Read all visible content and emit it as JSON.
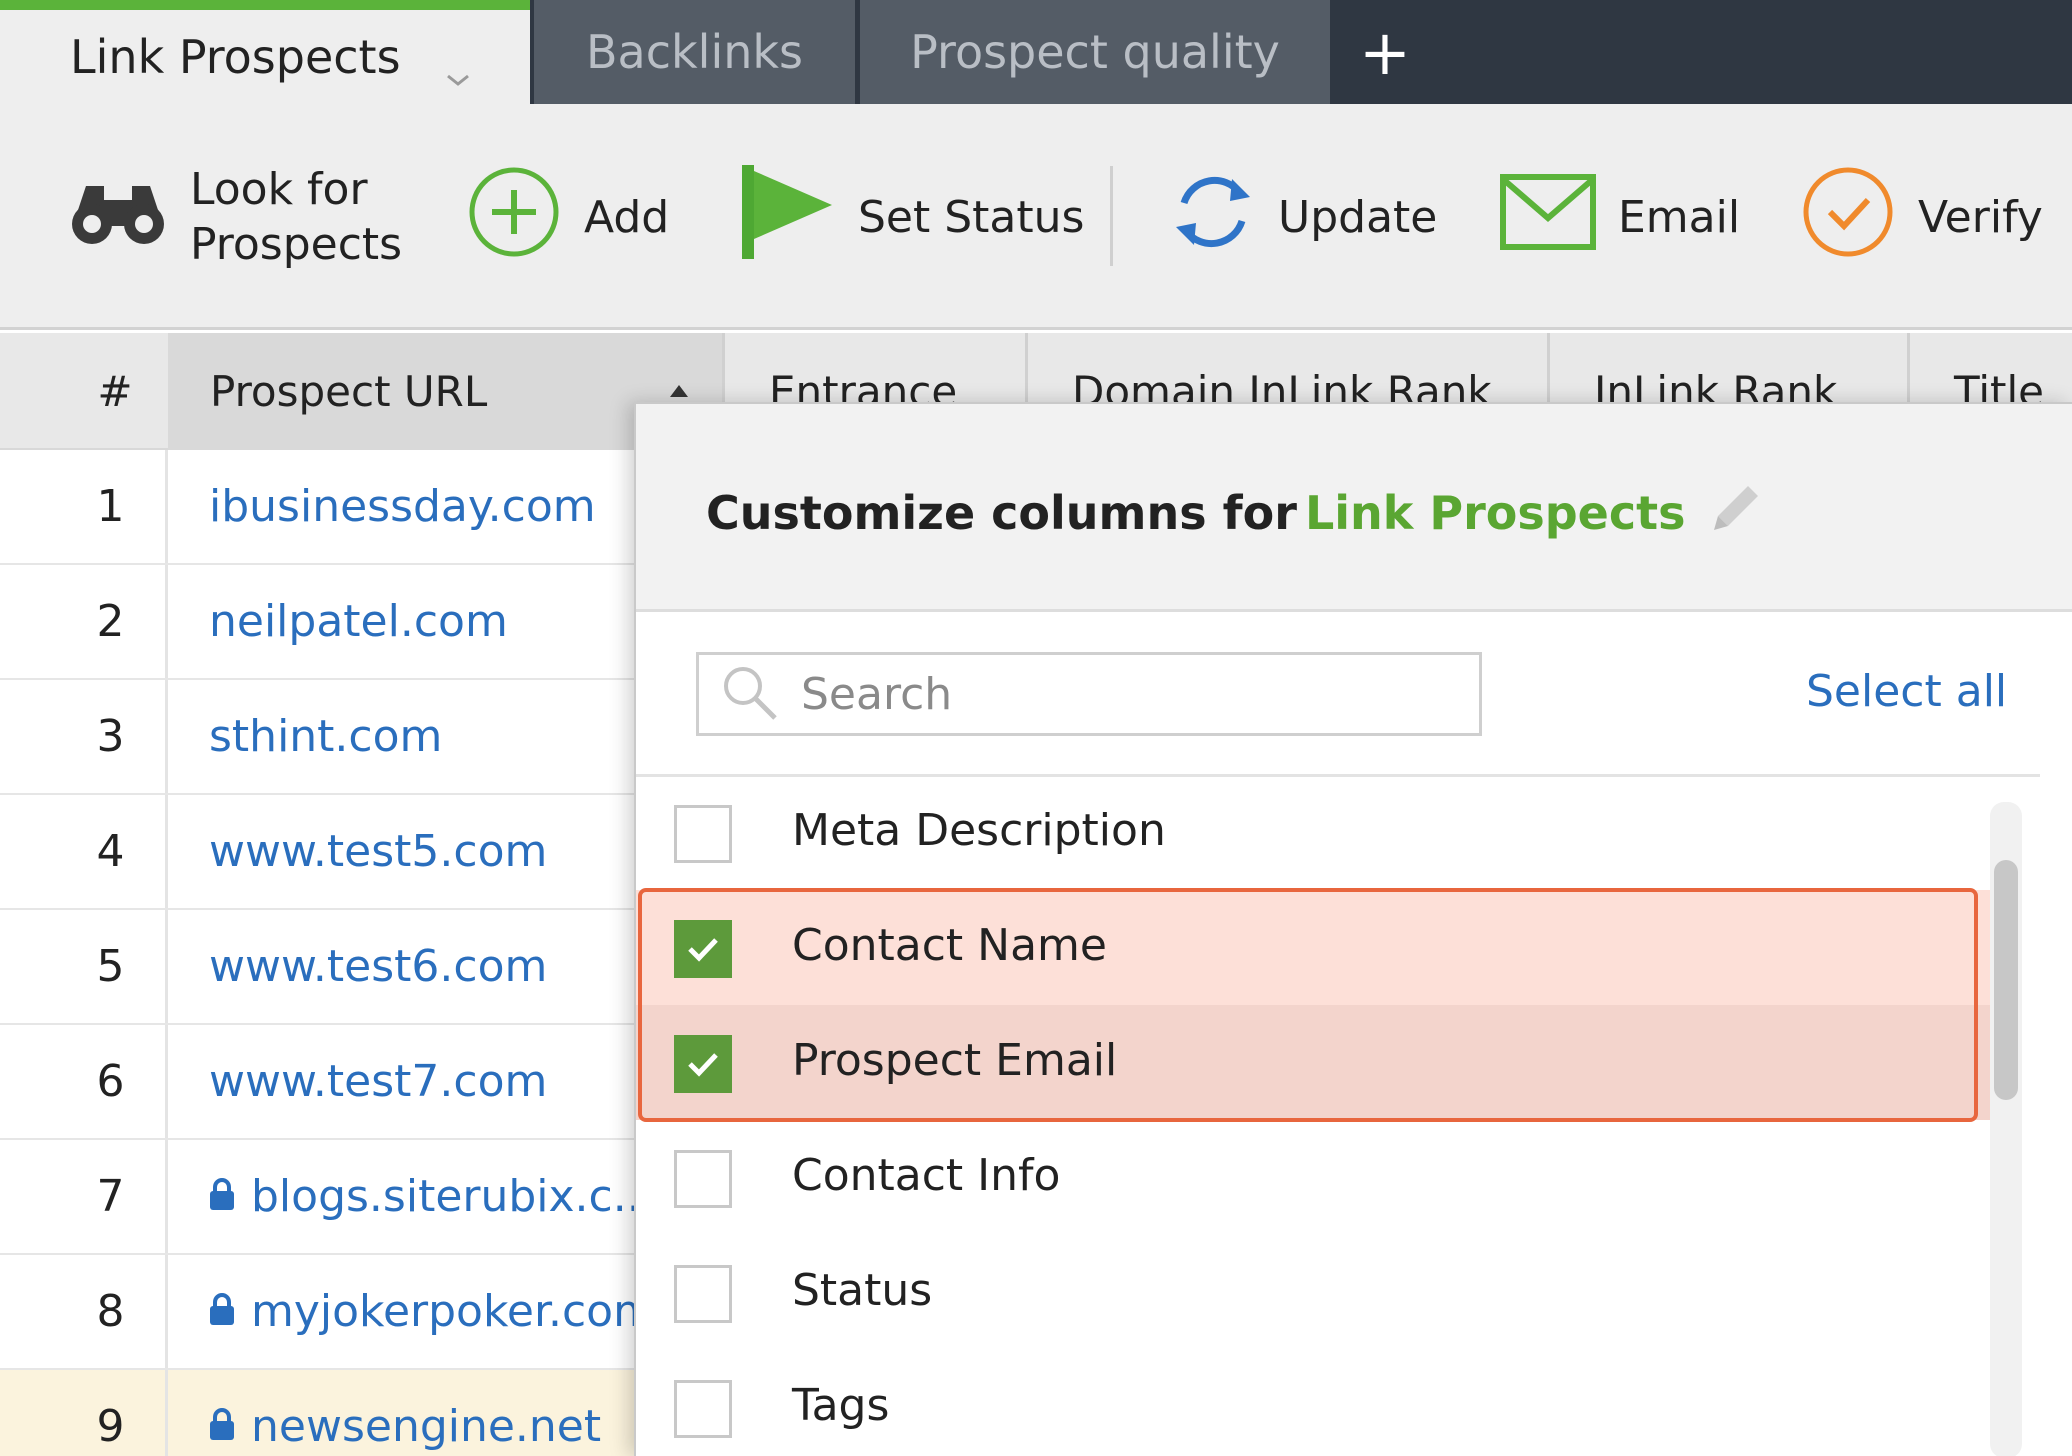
{
  "tabs": {
    "active": "Link Prospects",
    "others": [
      "Backlinks",
      "Prospect quality"
    ],
    "add": "+"
  },
  "toolbar": {
    "look_line1": "Look for",
    "look_line2": "Prospects",
    "add": "Add",
    "set_status": "Set Status",
    "update": "Update",
    "email": "Email",
    "verify": "Verify"
  },
  "table": {
    "headers": {
      "num": "#",
      "url": "Prospect URL",
      "entrance": "Entrance",
      "domain_inlink_rank": "Domain InLink Rank",
      "inlink_rank": "InLink Rank",
      "title": "Title"
    },
    "rows": [
      {
        "n": "1",
        "url": "ibusinessday.com",
        "secure": false
      },
      {
        "n": "2",
        "url": "neilpatel.com",
        "secure": false
      },
      {
        "n": "3",
        "url": "sthint.com",
        "secure": false
      },
      {
        "n": "4",
        "url": "www.test5.com",
        "secure": false
      },
      {
        "n": "5",
        "url": "www.test6.com",
        "secure": false
      },
      {
        "n": "6",
        "url": "www.test7.com",
        "secure": false
      },
      {
        "n": "7",
        "url": "blogs.siterubix.c...",
        "secure": true
      },
      {
        "n": "8",
        "url": "myjokerpoker.com",
        "secure": true
      },
      {
        "n": "9",
        "url": "newsengine.net",
        "secure": true
      }
    ]
  },
  "popup": {
    "title_prefix": "Customize columns for",
    "title_project": "Link Prospects",
    "search_placeholder": "Search",
    "select_all": "Select all",
    "options": [
      {
        "label": "Meta Description",
        "checked": false
      },
      {
        "label": "Contact Name",
        "checked": true
      },
      {
        "label": "Prospect Email",
        "checked": true
      },
      {
        "label": "Contact Info",
        "checked": false
      },
      {
        "label": "Status",
        "checked": false
      },
      {
        "label": "Tags",
        "checked": false
      }
    ]
  },
  "colors": {
    "accent_green": "#5aa632",
    "link_blue": "#2a6ebd",
    "highlight_orange": "#e8663e"
  }
}
